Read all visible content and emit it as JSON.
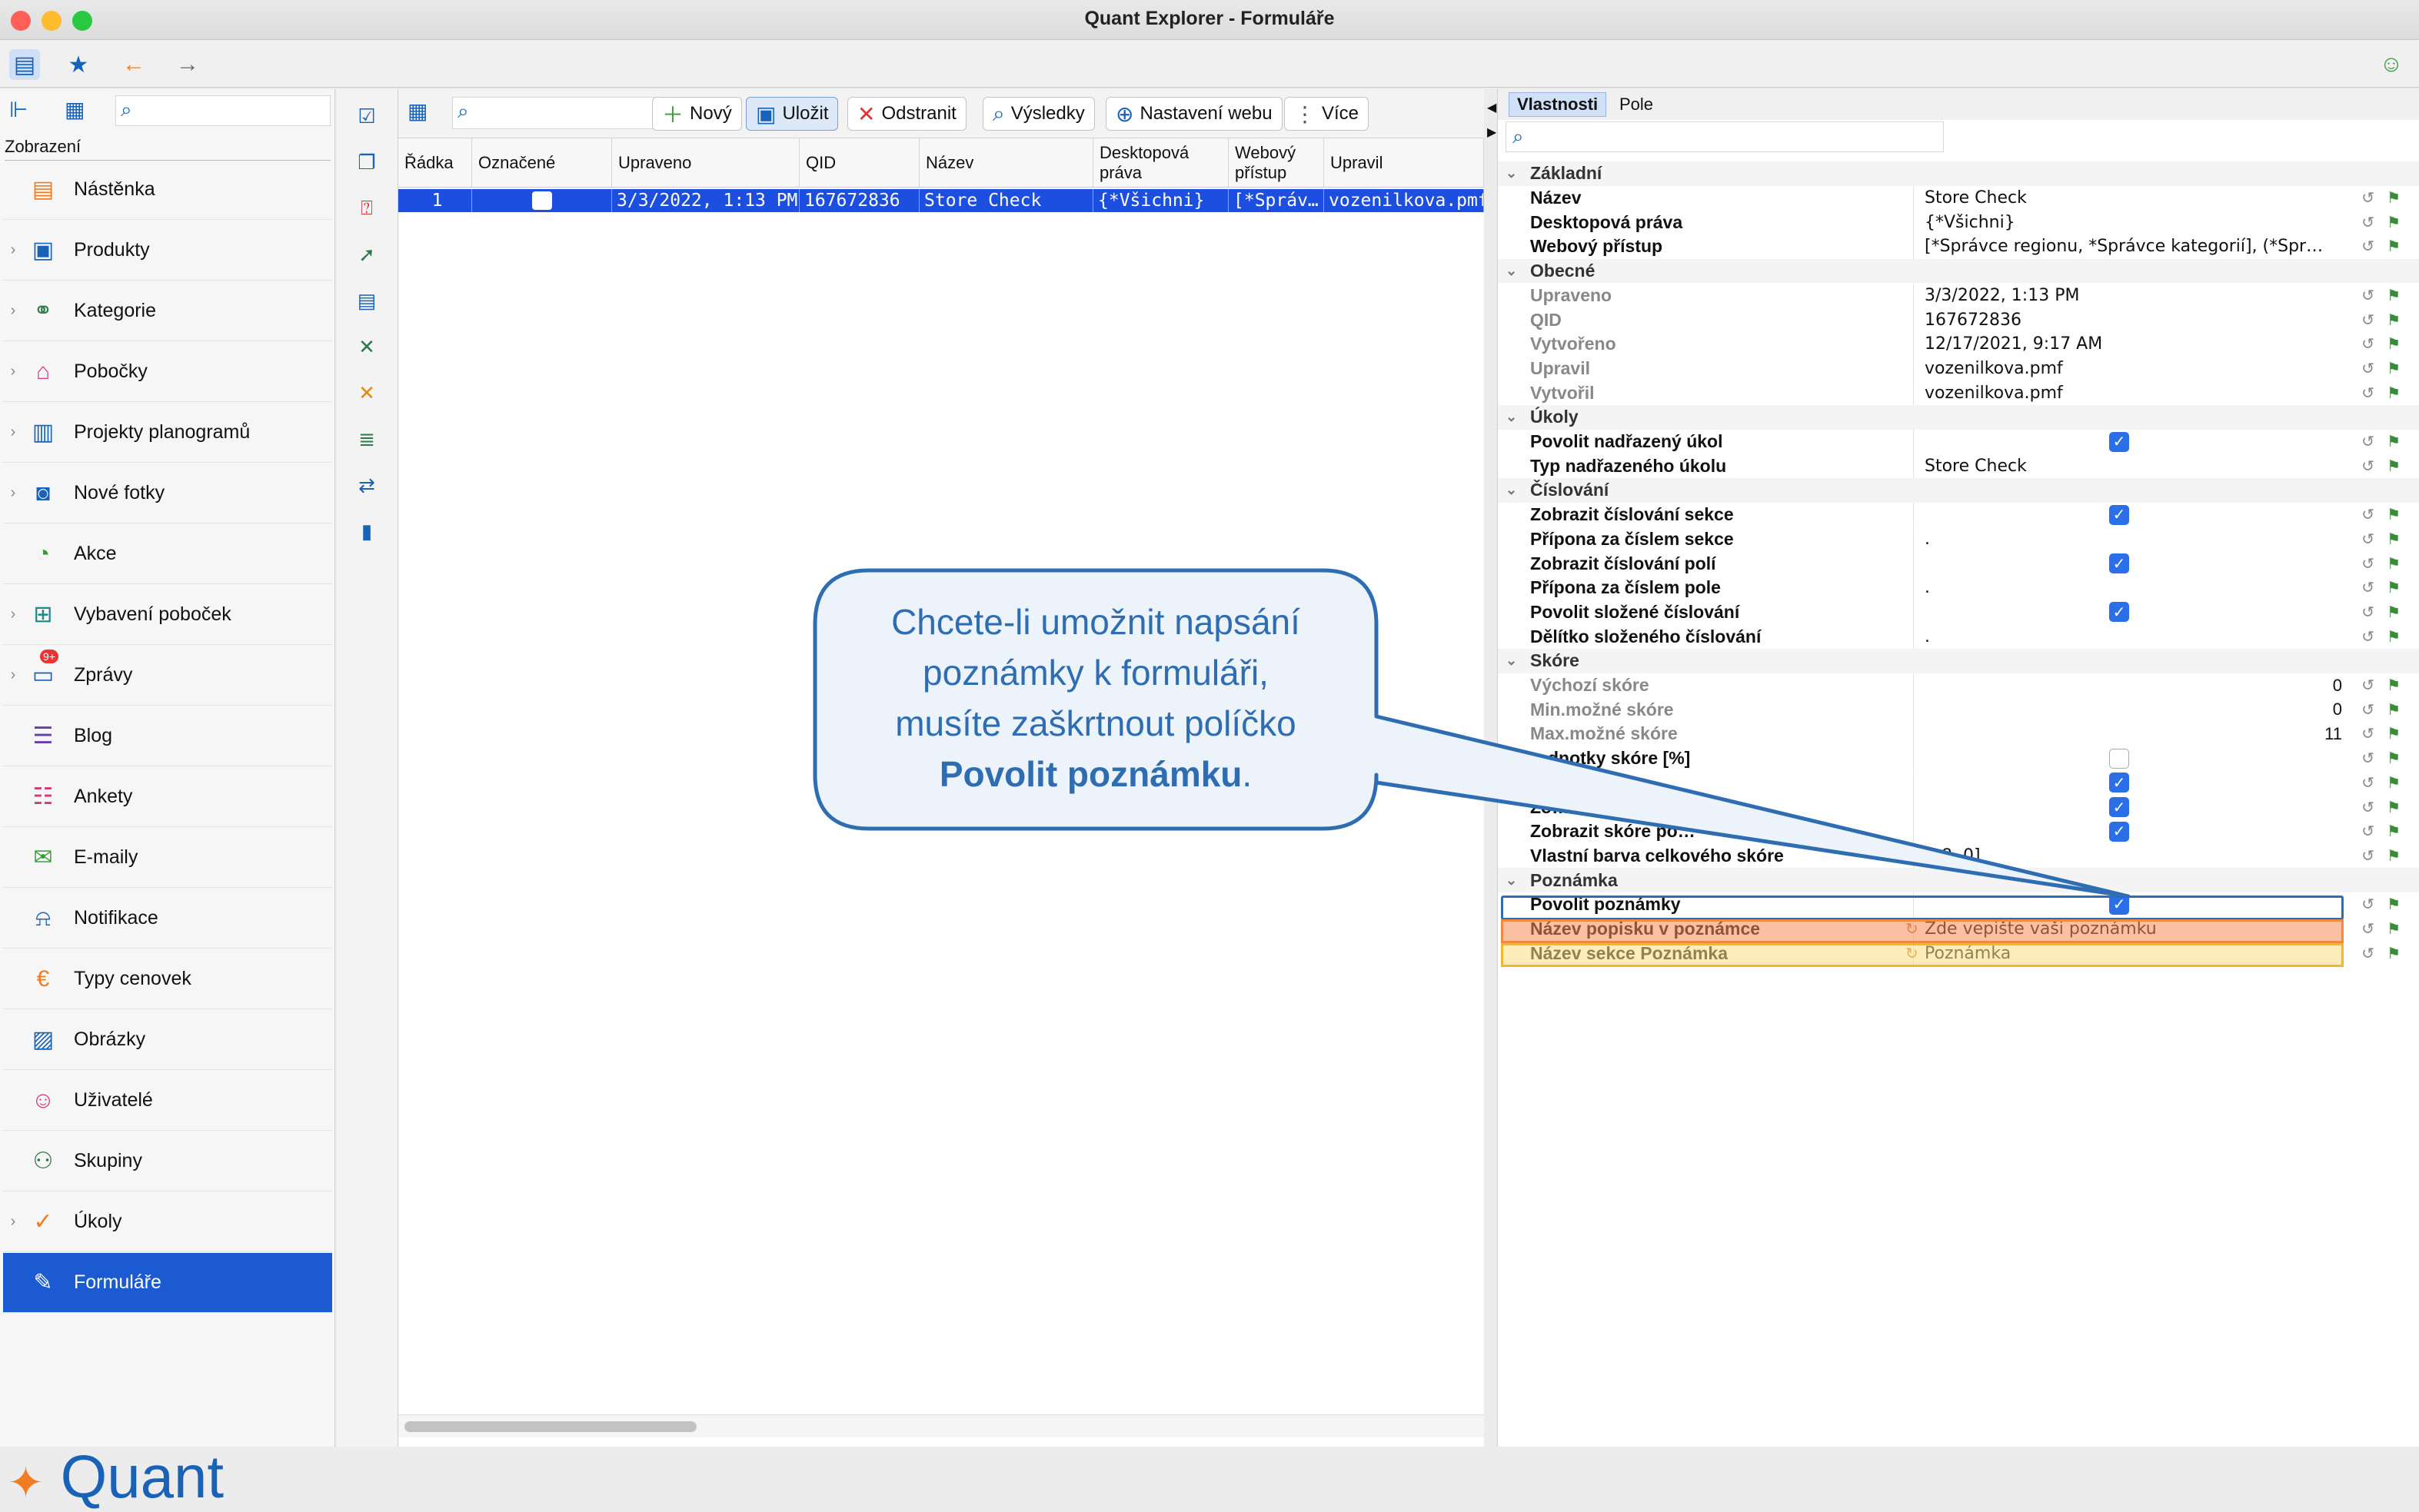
{
  "window": {
    "title": "Quant Explorer - Formuláře"
  },
  "toolbar": {
    "icons": [
      "sidebar-toggle-icon",
      "star-icon",
      "back-arrow-icon",
      "forward-arrow-icon",
      "smiley-icon"
    ]
  },
  "sidebar": {
    "section_label": "Zobrazení",
    "items": [
      {
        "label": "Nástěnka",
        "icon": "dashboard-icon",
        "chevron": false
      },
      {
        "label": "Produkty",
        "icon": "product-icon",
        "chevron": true
      },
      {
        "label": "Kategorie",
        "icon": "category-icon",
        "chevron": true
      },
      {
        "label": "Pobočky",
        "icon": "store-icon",
        "chevron": true
      },
      {
        "label": "Projekty planogramů",
        "icon": "planogram-icon",
        "chevron": true
      },
      {
        "label": "Nové fotky",
        "icon": "camera-icon",
        "chevron": true
      },
      {
        "label": "Akce",
        "icon": "promo-icon",
        "chevron": false
      },
      {
        "label": "Vybavení poboček",
        "icon": "equipment-icon",
        "chevron": true
      },
      {
        "label": "Zprávy",
        "icon": "message-icon",
        "chevron": true,
        "badge": "9+"
      },
      {
        "label": "Blog",
        "icon": "blog-icon",
        "chevron": false
      },
      {
        "label": "Ankety",
        "icon": "survey-icon",
        "chevron": false
      },
      {
        "label": "E-maily",
        "icon": "mail-icon",
        "chevron": false
      },
      {
        "label": "Notifikace",
        "icon": "bell-icon",
        "chevron": false
      },
      {
        "label": "Typy cenovek",
        "icon": "price-tag-icon",
        "chevron": false
      },
      {
        "label": "Obrázky",
        "icon": "image-icon",
        "chevron": false
      },
      {
        "label": "Uživatelé",
        "icon": "user-icon",
        "chevron": false
      },
      {
        "label": "Skupiny",
        "icon": "group-icon",
        "chevron": false
      },
      {
        "label": "Úkoly",
        "icon": "task-icon",
        "chevron": true
      },
      {
        "label": "Formuláře",
        "icon": "form-icon",
        "chevron": false,
        "active": true
      }
    ],
    "logo": "Quant"
  },
  "center": {
    "buttons": {
      "new": "Nový",
      "save": "Uložit",
      "delete": "Odstranit",
      "results": "Výsledky",
      "web": "Nastavení webu",
      "more": "Více"
    },
    "columns": [
      "Řádka",
      "Označené",
      "Upraveno",
      "QID",
      "Název",
      "Desktopová práva",
      "Webový přístup",
      "Upravil"
    ],
    "rows": [
      {
        "radka": "1",
        "upraveno": "3/3/2022, 1:13 PM",
        "qid": "167672836",
        "nazev": "Store Check",
        "desktop": "{*Všichni}",
        "web": "[*Správ…",
        "upravil": "vozenilkova.pmf"
      }
    ]
  },
  "right": {
    "tabs": [
      "Vlastnosti",
      "Pole"
    ],
    "groups": {
      "zakladni": "Základní",
      "obecne": "Obecné",
      "ukoly": "Úkoly",
      "cislovani": "Číslování",
      "skore": "Skóre",
      "poznamka": "Poznámka"
    },
    "props": {
      "nazev": {
        "name": "Název",
        "value": "Store Check"
      },
      "desktop": {
        "name": "Desktopová práva",
        "value": "{*Všichni}"
      },
      "web": {
        "name": "Webový přístup",
        "value": "[*Správce regionu, *Správce kategorií], (*Spr…"
      },
      "upraveno": {
        "name": "Upraveno",
        "value": "3/3/2022, 1:13 PM"
      },
      "qid": {
        "name": "QID",
        "value": "167672836"
      },
      "vytvoreno": {
        "name": "Vytvořeno",
        "value": "12/17/2021, 9:17 AM"
      },
      "upravil": {
        "name": "Upravil",
        "value": "vozenilkova.pmf"
      },
      "vytvoril": {
        "name": "Vytvořil",
        "value": "vozenilkova.pmf"
      },
      "povolit_nadrazeny": {
        "name": "Povolit nadřazený úkol",
        "checked": true
      },
      "typ_nadrazeneho": {
        "name": "Typ nadřazeného úkolu",
        "value": "Store Check"
      },
      "zobrazit_cislovani_sekce": {
        "name": "Zobrazit číslování sekce",
        "checked": true
      },
      "pripona_sekce": {
        "name": "Přípona za číslem sekce",
        "value": "."
      },
      "zobrazit_cislovani_poli": {
        "name": "Zobrazit číslování polí",
        "checked": true
      },
      "pripona_pole": {
        "name": "Přípona za číslem pole",
        "value": "."
      },
      "povolit_slozene": {
        "name": "Povolit složené číslování",
        "checked": true
      },
      "delitko": {
        "name": "Dělítko složeného číslování",
        "value": "."
      },
      "vychozi_skore": {
        "name": "Výchozí skóre",
        "value": "0"
      },
      "min_skore": {
        "name": "Min.možné skóre",
        "value": "0"
      },
      "max_skore": {
        "name": "Max.možné skóre",
        "value": "11"
      },
      "jednotky": {
        "name": "Jednotky skóre [%]",
        "name_visible": "…dnotky skóre [%]",
        "checked": false
      },
      "celkove": {
        "name_visible": "…kové skóre",
        "checked": true
      },
      "zob": {
        "name_visible": "Zo…",
        "checked": true
      },
      "zobrazit_skore_poli": {
        "name_visible": "Zobrazit skóre po…",
        "checked": true
      },
      "vlastni_barva": {
        "name": "Vlastní barva celkového skóre",
        "value": "…8, 0]"
      },
      "povolit_poznamku": {
        "name": "Povolit poznámky",
        "checked": true
      },
      "nazev_popisku": {
        "name": "Název popisku v poznámce",
        "value": "Zde vepište vaši poznámku"
      },
      "nazev_sekce": {
        "name": "Název sekce Poznámka",
        "value": "Poznámka"
      }
    }
  },
  "callout": {
    "line1": "Chcete-li umožnit napsání",
    "line2": "poznámky k formuláři,",
    "line3": "musíte zaškrtnout políčko",
    "bold": "Povolit poznámku",
    "tail": "."
  },
  "colors": {
    "accent": "#1b5ad1",
    "selection": "#1c4fe0",
    "callout_border": "#2f6db3",
    "highlight_orange": "#f6a57a",
    "highlight_yellow": "#fde4a3"
  }
}
